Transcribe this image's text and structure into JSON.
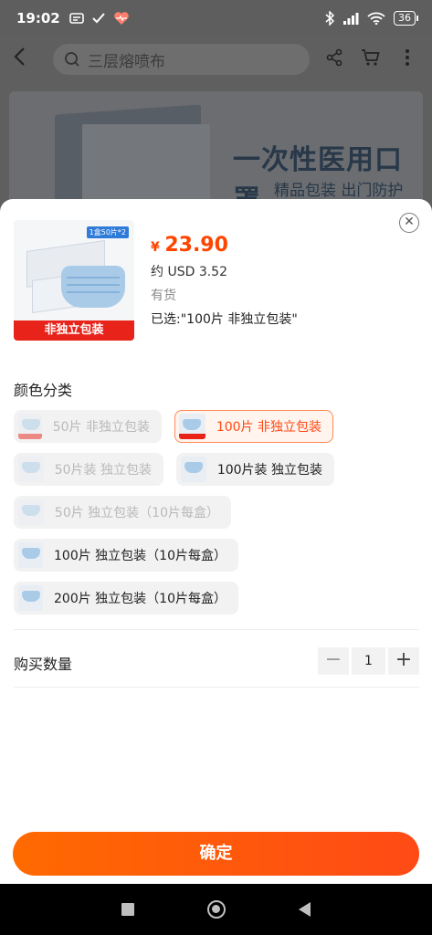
{
  "status_bar": {
    "time": "19:02",
    "battery": "36"
  },
  "background_page": {
    "search_placeholder": "三层熔喷布",
    "banner_title": "一次性医用口罩",
    "banner_subtitle": "精品包装 出门防护"
  },
  "product": {
    "image_badge": "1盒50片*2",
    "image_label": "非独立包装",
    "currency_symbol": "¥",
    "price": "23.90",
    "usd_price": "约 USD 3.52",
    "stock_status": "有货",
    "selected_text": "已选:\"100片 非独立包装\""
  },
  "variant_section": {
    "title": "颜色分类",
    "options": [
      {
        "label": "50片 非独立包装",
        "state": "disabled"
      },
      {
        "label": "100片 非独立包装",
        "state": "selected"
      },
      {
        "label": "50片装 独立包装",
        "state": "disabled"
      },
      {
        "label": "100片装 独立包装",
        "state": "available"
      },
      {
        "label": "50片 独立包装（10片每盒）",
        "state": "disabled"
      },
      {
        "label": "100片 独立包装（10片每盒）",
        "state": "available"
      },
      {
        "label": "200片 独立包装（10片每盒）",
        "state": "available"
      }
    ]
  },
  "quantity": {
    "label": "购买数量",
    "value": "1",
    "minus": "−",
    "plus": "+"
  },
  "confirm_button": "确定",
  "colors": {
    "accent": "#ff5000",
    "price": "#ff4400",
    "label_red": "#e8231a"
  }
}
